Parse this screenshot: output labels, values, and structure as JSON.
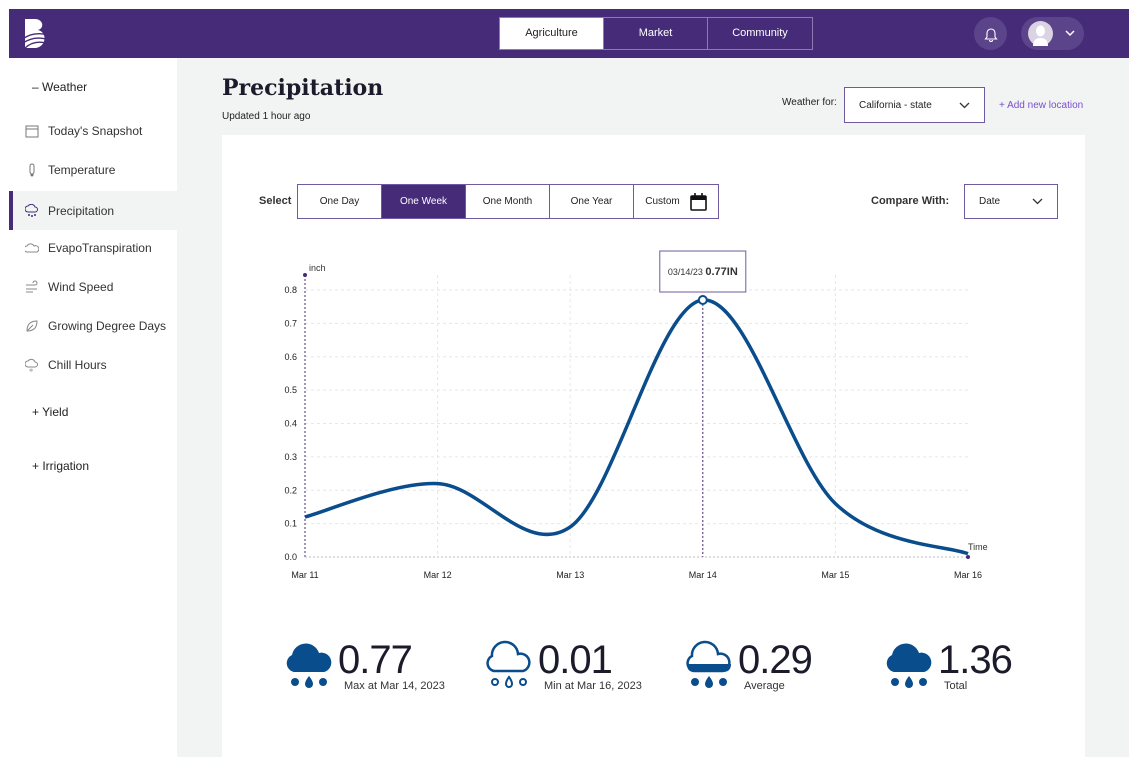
{
  "nav": {
    "tabs": [
      {
        "label": "Agriculture",
        "active": true
      },
      {
        "label": "Market"
      },
      {
        "label": "Community"
      }
    ],
    "icons": [
      "bell-icon",
      "user-avatar-icon",
      "chevron-down-icon"
    ]
  },
  "sidebar": {
    "weather_section": "– Weather",
    "items": [
      {
        "label": "Today's Snapshot",
        "icon": "calendar-icon"
      },
      {
        "label": "Temperature",
        "icon": "thermometer-icon"
      },
      {
        "label": "Precipitation",
        "icon": "rain-cloud-icon",
        "active": true
      },
      {
        "label": "EvapoTranspiration",
        "icon": "evaporation-icon"
      },
      {
        "label": "Wind Speed",
        "icon": "wind-icon"
      },
      {
        "label": "Growing Degree Days",
        "icon": "leaf-icon"
      },
      {
        "label": "Chill Hours",
        "icon": "cold-cloud-icon"
      }
    ],
    "yield_section": "+ Yield",
    "irrigation_section": "+ Irrigation"
  },
  "header": {
    "title": "Precipitation",
    "updated": "Updated 1 hour ago",
    "weather_for_label": "Weather for:",
    "location": "California - state",
    "add_location": "+ Add new location"
  },
  "controls": {
    "select_label": "Select",
    "ranges": [
      {
        "label": "One Day"
      },
      {
        "label": "One Week",
        "active": true
      },
      {
        "label": "One Month"
      },
      {
        "label": "One Year"
      },
      {
        "label": "Custom"
      }
    ],
    "compare_label": "Compare With:",
    "compare_value": "Date"
  },
  "colors": {
    "brand": "#452b78",
    "line": "#0a4d8c",
    "accent_link": "#7a4fd0"
  },
  "chart_data": {
    "type": "line",
    "ylabel": "inch",
    "xlabel": "Time",
    "categories": [
      "Mar 11",
      "Mar 12",
      "Mar 13",
      "Mar 14",
      "Mar 15",
      "Mar 16"
    ],
    "values": [
      0.12,
      0.22,
      0.09,
      0.77,
      0.16,
      0.01
    ],
    "ylim": [
      0,
      0.8
    ],
    "yticks": [
      "0.0",
      "0.1",
      "0.2",
      "0.3",
      "0.4",
      "0.5",
      "0.6",
      "0.7",
      "0.8"
    ],
    "grid": true,
    "tooltip": {
      "date": "03/14/23",
      "value": "0.77IN",
      "index": 3
    }
  },
  "stats": [
    {
      "value": "0.77",
      "label": "Max at Mar 14, 2023",
      "icon": "heavy-rain-icon"
    },
    {
      "value": "0.01",
      "label": "Min at Mar 16, 2023",
      "icon": "light-rain-icon"
    },
    {
      "value": "0.29",
      "label": "Average",
      "icon": "medium-rain-icon"
    },
    {
      "value": "1.36",
      "label": "Total",
      "icon": "heavy-rain-icon"
    }
  ]
}
